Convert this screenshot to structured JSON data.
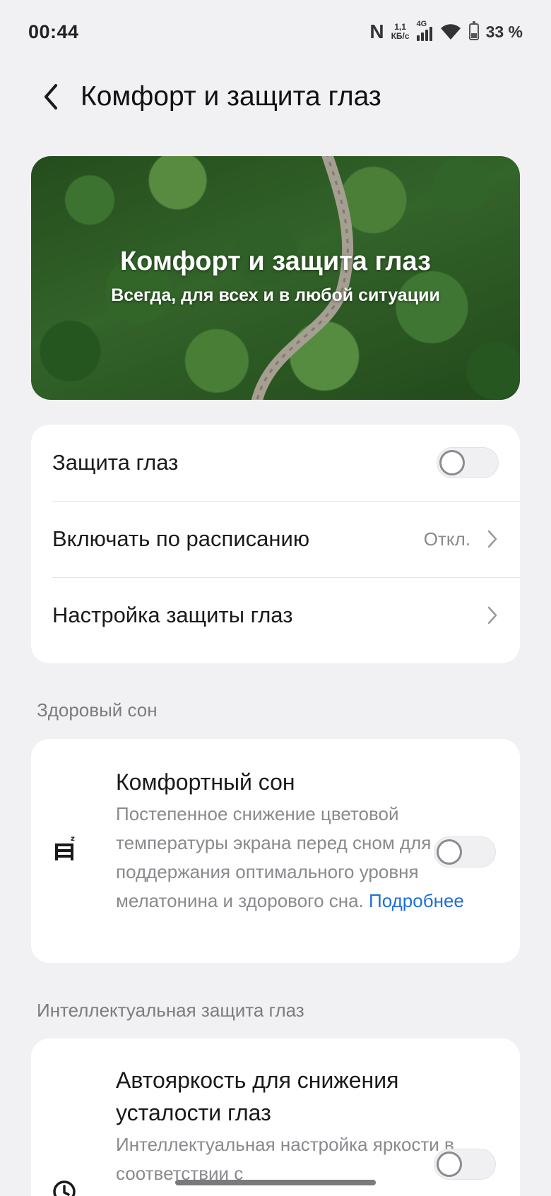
{
  "status_bar": {
    "time": "00:44",
    "nfc": "N",
    "speed_value": "1,1",
    "speed_unit": "КБ/с",
    "network": "4G",
    "battery_percent": "33 %",
    "battery_level": 0.33
  },
  "header": {
    "title": "Комфорт и защита глаз",
    "back_icon": "chevron-left-icon"
  },
  "banner": {
    "title": "Комфорт и защита глаз",
    "subtitle": "Всегда, для всех и в любой ситуации"
  },
  "main_settings": {
    "eye_protection": {
      "label": "Защита глаз",
      "enabled": false
    },
    "schedule": {
      "label": "Включать по расписанию",
      "value": "Откл."
    },
    "eye_settings": {
      "label": "Настройка защиты глаз"
    }
  },
  "healthy_sleep": {
    "section_title": "Здоровый сон",
    "comfort_sleep": {
      "icon": "bed-sleep-icon",
      "title": "Комфортный сон",
      "description": "Постепенное снижение цветовой температуры экрана перед сном для поддержания оптимального уровня мелатонина и здорового сна.",
      "link": "Подробнее",
      "enabled": false
    }
  },
  "smart_protection": {
    "section_title": "Интеллектуальная защита глаз",
    "auto_brightness": {
      "icon": "clock-icon",
      "title": "Автояркость для снижения усталости глаз",
      "description": "Интеллектуальная настройка яркости в соответствии с",
      "enabled": false
    }
  },
  "colors": {
    "background": "#f1f1f3",
    "card": "#ffffff",
    "link": "#1f6fd6",
    "secondary_text": "#8a8a8e"
  }
}
